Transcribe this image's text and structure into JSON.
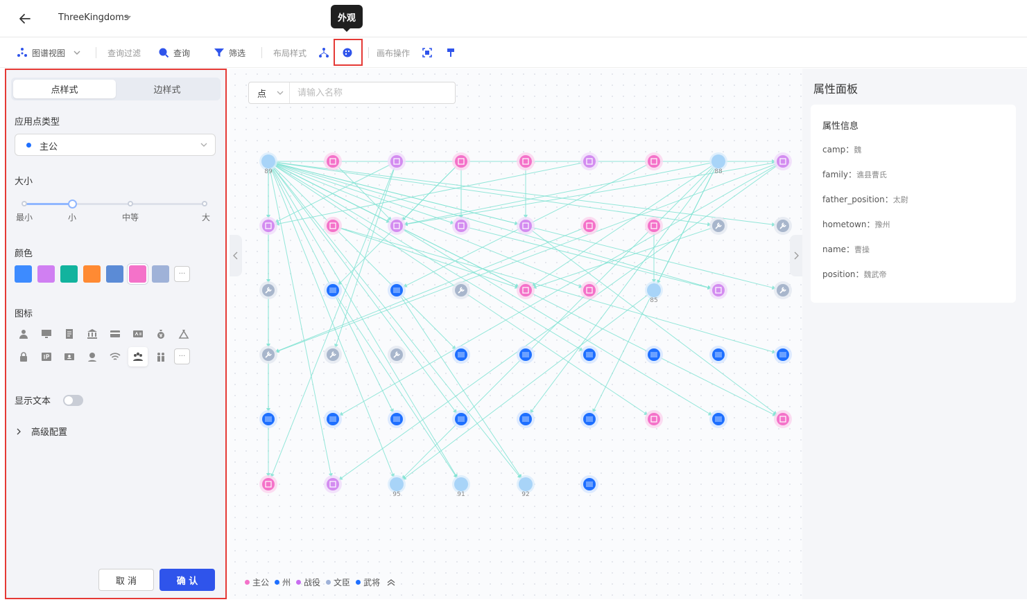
{
  "header": {
    "title": "ThreeKingdoms",
    "tooltip": "外观"
  },
  "toolbar": {
    "graph_view": "图谱视图",
    "query_filter": "查询过滤",
    "query": "查询",
    "filter": "筛选",
    "layout_style": "布局样式",
    "canvas_ops": "画布操作"
  },
  "left_panel": {
    "tabs": [
      "点样式",
      "边样式"
    ],
    "node_type_label": "应用点类型",
    "node_type_value": "主公",
    "size_label": "大小",
    "size_marks": [
      "最小",
      "小",
      "中等",
      "大"
    ],
    "size_value": "小",
    "color_label": "颜色",
    "colors": [
      "#3d8bff",
      "#d07ff2",
      "#12b39e",
      "#ff8a33",
      "#5b8bd6",
      "#f472c9",
      "#9fb2d8"
    ],
    "selected_color": "#f472c9",
    "icon_label": "图标",
    "icons": [
      "user-icon",
      "monitor-icon",
      "document-icon",
      "bank-icon",
      "card-icon",
      "id-card-icon",
      "money-bag-icon",
      "money-bag-outline-icon",
      "lock-icon",
      "ip-icon",
      "contact-card-icon",
      "user-badge-icon",
      "wifi-icon",
      "group-icon",
      "family-icon"
    ],
    "selected_icon": "group-icon",
    "more": "···",
    "show_text_label": "显示文本",
    "show_text": false,
    "advanced_label": "高级配置",
    "cancel": "取 消",
    "confirm": "确 认"
  },
  "canvas": {
    "search_type": "点",
    "search_placeholder": "请输入名称",
    "node_labels": [
      "89",
      "88",
      "85",
      "95",
      "91",
      "92"
    ],
    "legend": [
      {
        "label": "主公",
        "color": "#f472c9"
      },
      {
        "label": "州",
        "color": "#1e6fff"
      },
      {
        "label": "战役",
        "color": "#c86df0"
      },
      {
        "label": "文臣",
        "color": "#9fb2d8"
      },
      {
        "label": "武将",
        "color": "#1e6fff"
      }
    ]
  },
  "right_panel": {
    "title": "属性面板",
    "subtitle": "属性信息",
    "props": [
      {
        "key": "camp：",
        "value": "魏"
      },
      {
        "key": "family：",
        "value": "谯县曹氏"
      },
      {
        "key": "father_position：",
        "value": "太尉"
      },
      {
        "key": "hometown：",
        "value": "豫州"
      },
      {
        "key": "name：",
        "value": "曹操"
      },
      {
        "key": "position：",
        "value": "魏武帝"
      }
    ]
  },
  "colors": {
    "edge": "#80e3d3",
    "primary": "#2f54eb",
    "highlight": "#e53935"
  }
}
